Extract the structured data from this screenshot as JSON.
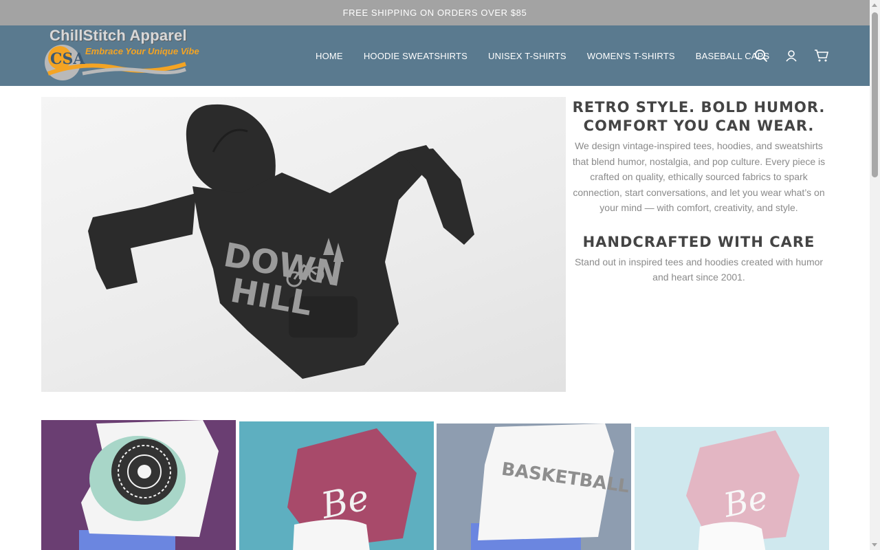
{
  "announcement": "FREE SHIPPING ON ORDERS OVER $85",
  "brand": {
    "name": "ChillStitch Apparel",
    "tagline": "Embrace Your Unique Vibe",
    "monogram": "CSA",
    "colors": {
      "header": "#5a7a8f",
      "accent": "#f4a423"
    }
  },
  "nav": {
    "items": [
      {
        "label": "HOME"
      },
      {
        "label": "HOODIE SWEATSHIRTS"
      },
      {
        "label": "UNISEX T-SHIRTS"
      },
      {
        "label": "WOMEN'S T-SHIRTS"
      },
      {
        "label": "BASEBALL CAPS"
      }
    ]
  },
  "header_icons": [
    "search-icon",
    "account-icon",
    "cart-icon"
  ],
  "hero": {
    "image_graphic": {
      "line1": "DOWN",
      "line2": "HILL"
    },
    "headline": "RETRO STYLE. BOLD HUMOR. COMFORT YOU CAN WEAR.",
    "body": "We design vintage-inspired tees, hoodies, and sweatshirts that blend humor, nostalgia, and pop culture. Every piece is crafted on quality, ethically sourced fabrics to spark connection, start conversations, and let you wear what’s on your mind — with comfort, creativity, and style.",
    "subheadline": "HANDCRAFTED WITH CARE",
    "subbody": "Stand out in inspired tees and hoodies created with humor and heart since 2001."
  },
  "products": [
    {
      "graphic": "",
      "background": "#6a3e72"
    },
    {
      "graphic": "Be",
      "background": "#5eafc0"
    },
    {
      "graphic": "BASKETBALL",
      "background": "#8e9db0"
    },
    {
      "graphic": "Be",
      "background": "#cfe8ee"
    }
  ]
}
